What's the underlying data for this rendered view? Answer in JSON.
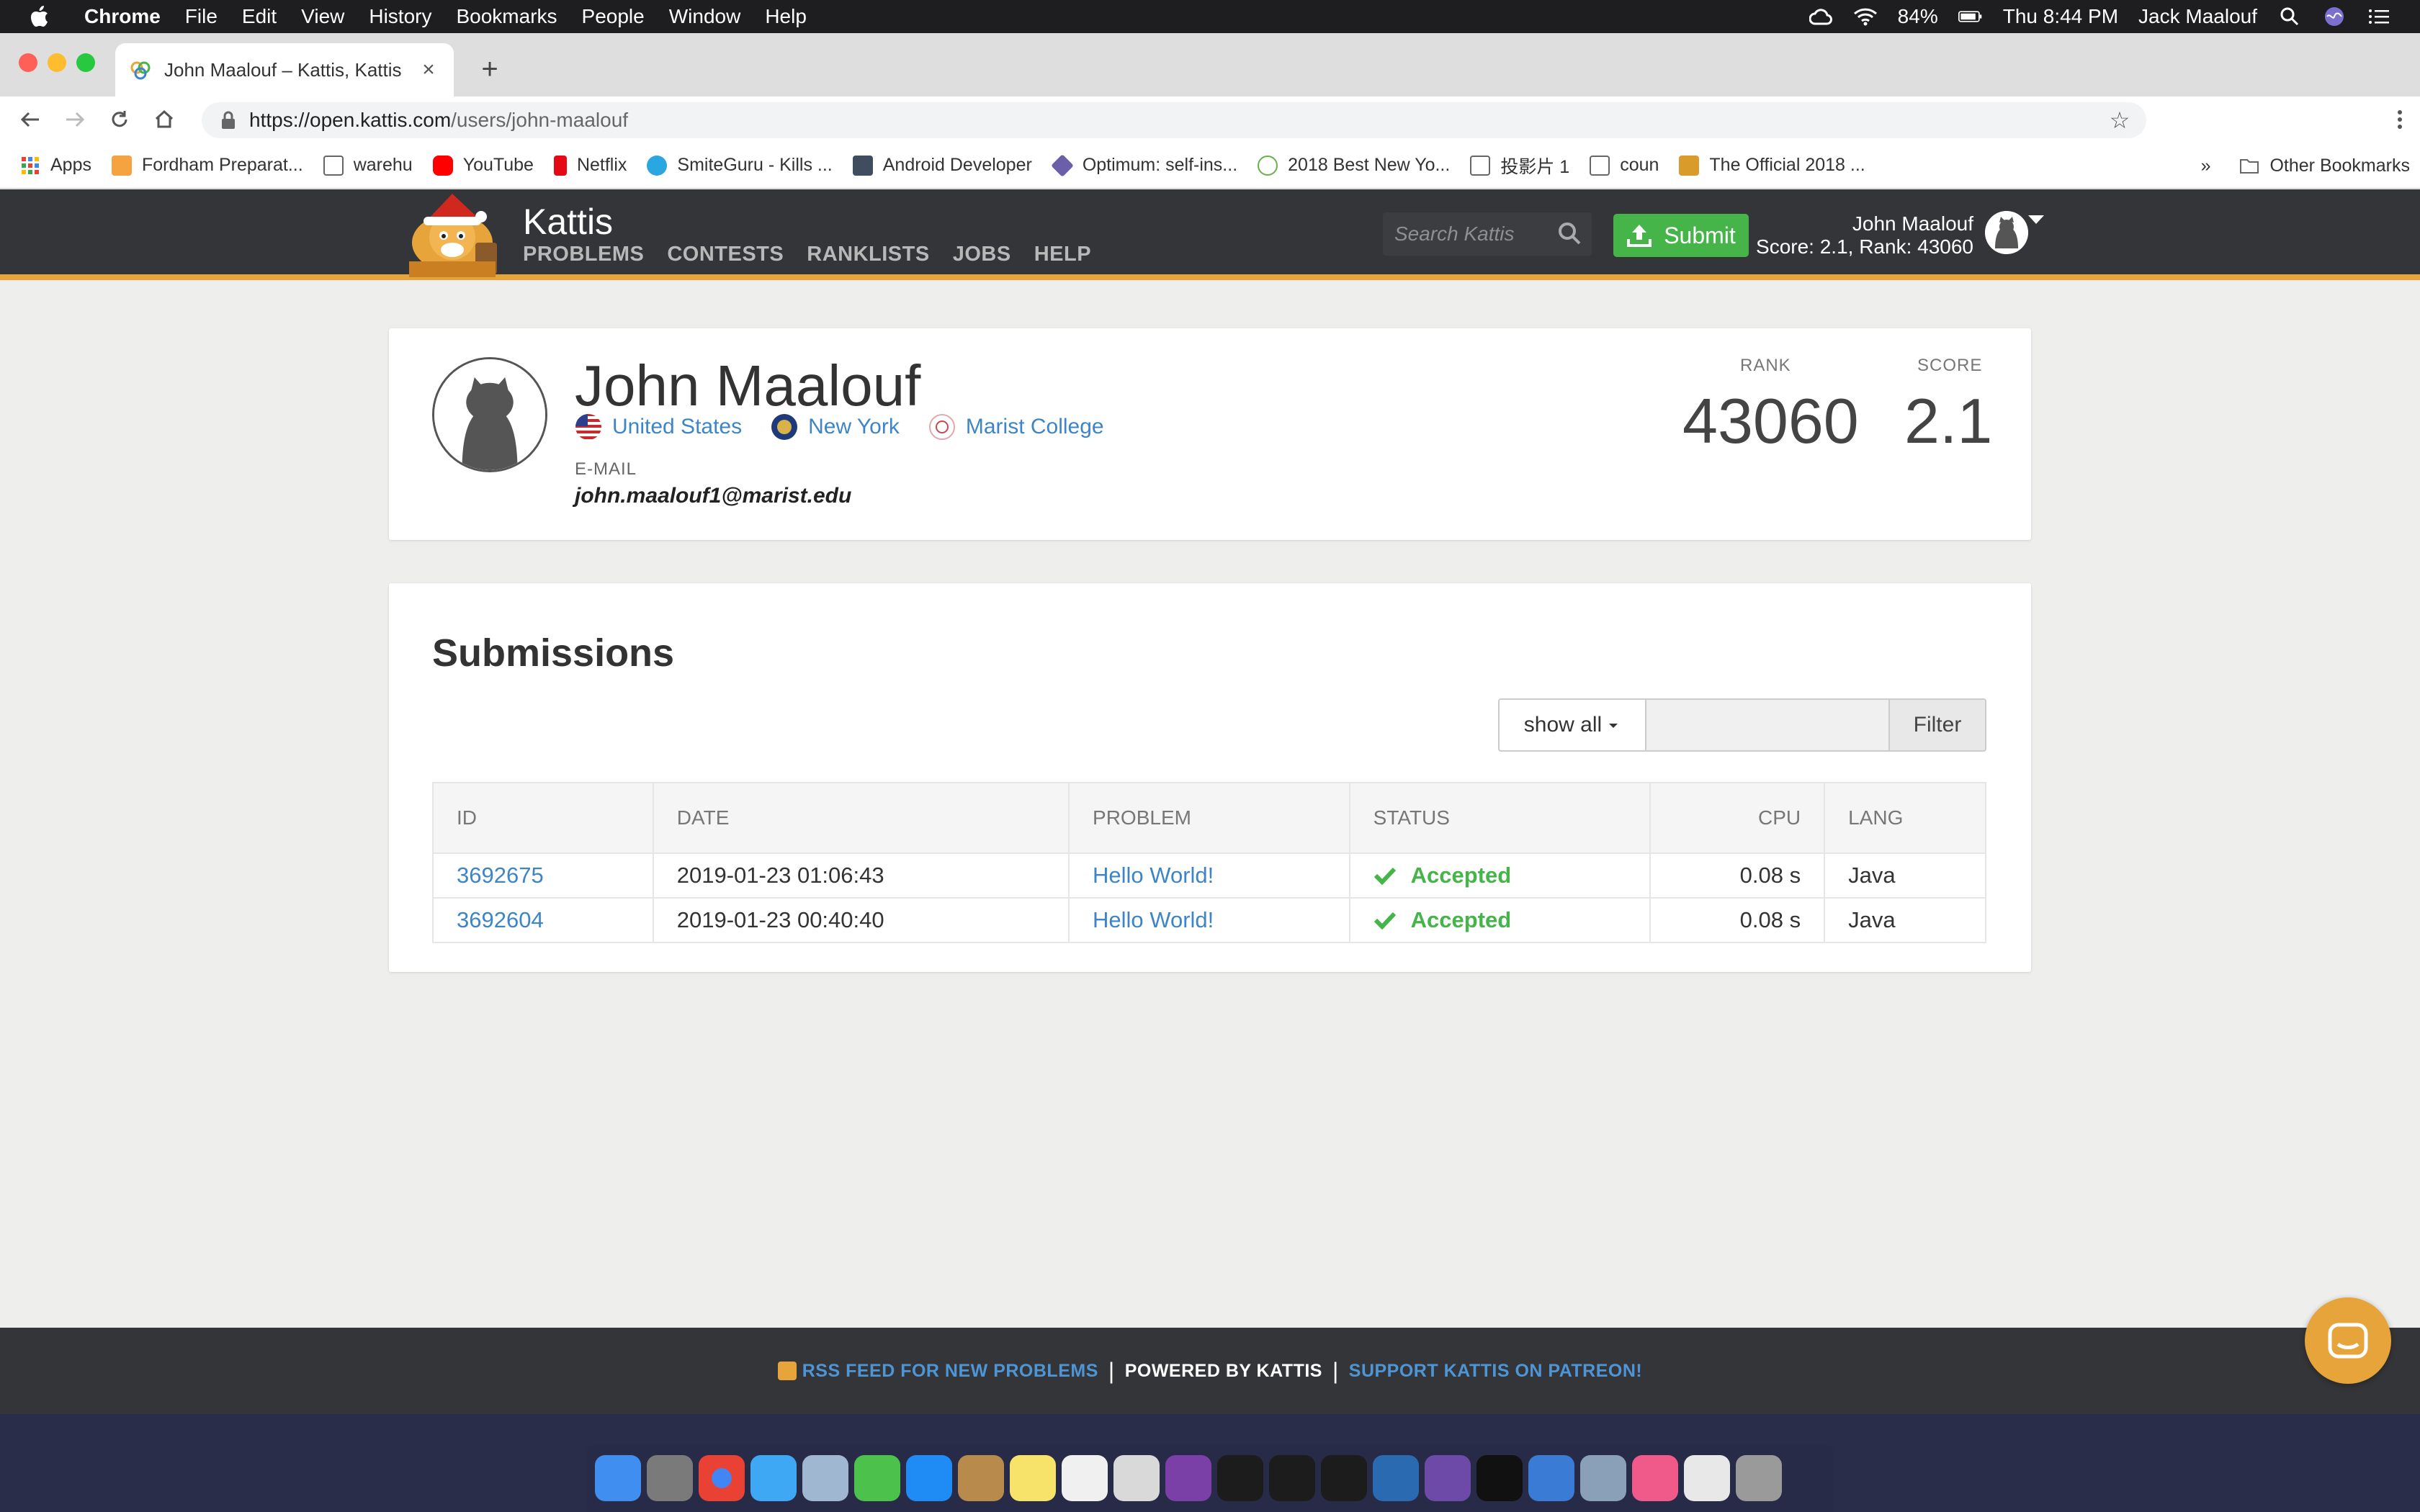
{
  "menubar": {
    "app": "Chrome",
    "items": [
      "File",
      "Edit",
      "View",
      "History",
      "Bookmarks",
      "People",
      "Window",
      "Help"
    ],
    "battery": "84%",
    "clock": "Thu 8:44 PM",
    "user": "Jack Maalouf"
  },
  "tab": {
    "title": "John Maalouf – Kattis, Kattis",
    "new_tab": "+"
  },
  "omnibox": {
    "url_host": "https://open.kattis.com",
    "url_path": "/users/john-maalouf"
  },
  "bookmarks": {
    "items": [
      {
        "label": "Apps",
        "color": "#e94235"
      },
      {
        "label": "Fordham Preparat...",
        "color": "#f4a340"
      },
      {
        "label": "warehu",
        "color": "#ffffff"
      },
      {
        "label": "YouTube",
        "color": "#ff0000"
      },
      {
        "label": "Netflix",
        "color": "#e50914"
      },
      {
        "label": "SmiteGuru - Kills ...",
        "color": "#2aa7e0"
      },
      {
        "label": "Android Developer",
        "color": "#3f4d5e"
      },
      {
        "label": "Optimum: self-ins...",
        "color": "#6a5fa8"
      },
      {
        "label": "2018 Best New Yo...",
        "color": "#6ab04c"
      },
      {
        "label": "投影片 1",
        "color": "#ffffff"
      },
      {
        "label": "coun",
        "color": "#ffffff"
      },
      {
        "label": "The Official 2018 ...",
        "color": "#d99c2b"
      }
    ],
    "overflow": "»",
    "other": "Other Bookmarks"
  },
  "kattis": {
    "brand": "Kattis",
    "nav": [
      "PROBLEMS",
      "CONTESTS",
      "RANKLISTS",
      "JOBS",
      "HELP"
    ],
    "search_placeholder": "Search Kattis",
    "submit": "Submit",
    "user_name": "John Maalouf",
    "user_stats": "Score: 2.1, Rank: 43060",
    "accent": "#e7a43a",
    "green": "#45b549",
    "link": "#3d85c6"
  },
  "profile": {
    "name": "John Maalouf",
    "country": "United States",
    "region": "New York",
    "school": "Marist College",
    "email_label": "E-MAIL",
    "email": "john.maalouf1@marist.edu",
    "rank_label": "RANK",
    "rank": "43060",
    "score_label": "SCORE",
    "score": "2.1"
  },
  "submissions": {
    "title": "Submissions",
    "filter_select": "show all",
    "filter_button": "Filter",
    "columns": [
      "ID",
      "DATE",
      "PROBLEM",
      "STATUS",
      "CPU",
      "LANG"
    ],
    "rows": [
      {
        "id": "3692675",
        "date": "2019-01-23 01:06:43",
        "problem": "Hello World!",
        "status": "Accepted",
        "cpu": "0.08 s",
        "lang": "Java"
      },
      {
        "id": "3692604",
        "date": "2019-01-23 00:40:40",
        "problem": "Hello World!",
        "status": "Accepted",
        "cpu": "0.08 s",
        "lang": "Java"
      }
    ]
  },
  "footer": {
    "rss": "RSS FEED FOR NEW PROBLEMS",
    "powered": "POWERED BY KATTIS",
    "patreon": "SUPPORT KATTIS ON PATREON!",
    "separator": "|"
  }
}
